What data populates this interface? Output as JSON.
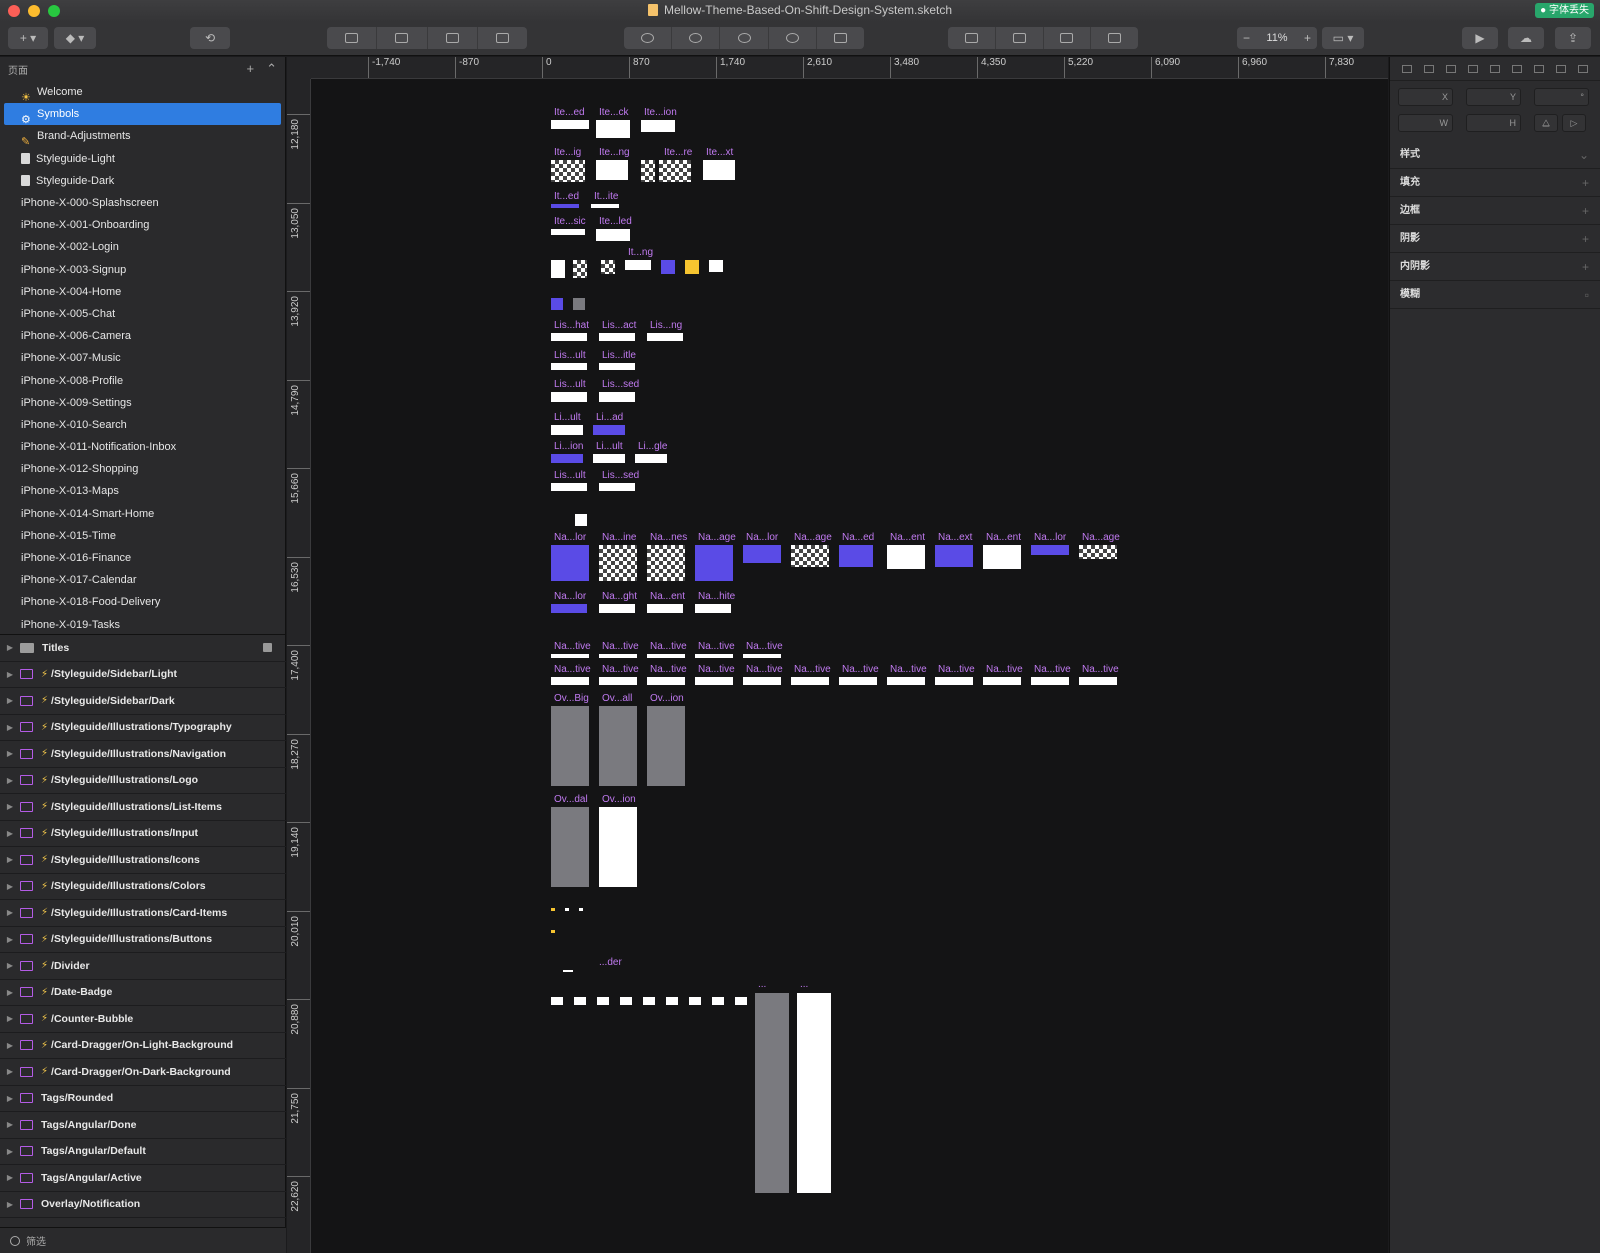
{
  "window": {
    "title": "Mellow-Theme-Based-On-Shift-Design-System.sketch",
    "badge": "● 字体丢失"
  },
  "toolbar": {
    "zoom": "11%"
  },
  "pages_header": "页面",
  "pages": [
    {
      "label": "Welcome",
      "icon": "sun-icon"
    },
    {
      "label": "Symbols",
      "icon": "gear-icon",
      "selected": true
    },
    {
      "label": "Brand-Adjustments",
      "icon": "pencil-icon"
    },
    {
      "label": "Styleguide-Light",
      "icon": "document-icon"
    },
    {
      "label": "Styleguide-Dark",
      "icon": "document-icon"
    },
    {
      "label": "iPhone-X-000-Splashscreen"
    },
    {
      "label": "iPhone-X-001-Onboarding"
    },
    {
      "label": "iPhone-X-002-Login"
    },
    {
      "label": "iPhone-X-003-Signup"
    },
    {
      "label": "iPhone-X-004-Home"
    },
    {
      "label": "iPhone-X-005-Chat"
    },
    {
      "label": "iPhone-X-006-Camera"
    },
    {
      "label": "iPhone-X-007-Music"
    },
    {
      "label": "iPhone-X-008-Profile"
    },
    {
      "label": "iPhone-X-009-Settings"
    },
    {
      "label": "iPhone-X-010-Search"
    },
    {
      "label": "iPhone-X-011-Notification-Inbox"
    },
    {
      "label": "iPhone-X-012-Shopping"
    },
    {
      "label": "iPhone-X-013-Maps"
    },
    {
      "label": "iPhone-X-014-Smart-Home"
    },
    {
      "label": "iPhone-X-015-Time"
    },
    {
      "label": "iPhone-X-016-Finance"
    },
    {
      "label": "iPhone-X-017-Calendar"
    },
    {
      "label": "iPhone-X-018-Food-Delivery"
    },
    {
      "label": "iPhone-X-019-Tasks"
    }
  ],
  "layers": [
    {
      "label": "Titles",
      "type": "folder",
      "locked": true
    },
    {
      "label": "/Styleguide/Sidebar/Light",
      "type": "symbol"
    },
    {
      "label": "/Styleguide/Sidebar/Dark",
      "type": "symbol"
    },
    {
      "label": "/Styleguide/Illustrations/Typography",
      "type": "symbol"
    },
    {
      "label": "/Styleguide/Illustrations/Navigation",
      "type": "symbol"
    },
    {
      "label": "/Styleguide/Illustrations/Logo",
      "type": "symbol"
    },
    {
      "label": "/Styleguide/Illustrations/List-Items",
      "type": "symbol"
    },
    {
      "label": "/Styleguide/Illustrations/Input",
      "type": "symbol"
    },
    {
      "label": "/Styleguide/Illustrations/Icons",
      "type": "symbol"
    },
    {
      "label": "/Styleguide/Illustrations/Colors",
      "type": "symbol"
    },
    {
      "label": "/Styleguide/Illustrations/Card-Items",
      "type": "symbol"
    },
    {
      "label": "/Styleguide/Illustrations/Buttons",
      "type": "symbol"
    },
    {
      "label": "/Divider",
      "type": "symbol"
    },
    {
      "label": "/Date-Badge",
      "type": "symbol"
    },
    {
      "label": "/Counter-Bubble",
      "type": "symbol"
    },
    {
      "label": "/Card-Dragger/On-Light-Background",
      "type": "symbol"
    },
    {
      "label": "/Card-Dragger/On-Dark-Background",
      "type": "symbol"
    },
    {
      "label": "Tags/Rounded",
      "type": "plain"
    },
    {
      "label": "Tags/Angular/Done",
      "type": "plain"
    },
    {
      "label": "Tags/Angular/Default",
      "type": "plain"
    },
    {
      "label": "Tags/Angular/Active",
      "type": "plain"
    },
    {
      "label": "Overlay/Notification",
      "type": "plain"
    }
  ],
  "filter": "筛选",
  "rulers": {
    "h": [
      "-1,740",
      "-870",
      "0",
      "870",
      "1,740",
      "2,610",
      "3,480",
      "4,350",
      "5,220",
      "6,090",
      "6,960",
      "7,830"
    ],
    "v": [
      "12,180",
      "13,050",
      "13,920",
      "14,790",
      "15,660",
      "16,530",
      "17,400",
      "18,270",
      "19,140",
      "20,010",
      "20,880",
      "21,750",
      "22,620"
    ]
  },
  "inspector": {
    "fields": {
      "x": "X",
      "y": "Y",
      "w": "W",
      "h": "H",
      "deg": "°"
    },
    "sections": [
      "样式",
      "填充",
      "边框",
      "阴影",
      "内阴影",
      "模糊"
    ]
  },
  "artboard_labels": {
    "r1": [
      "Ite...ed",
      "Ite...ck",
      "Ite...ion"
    ],
    "r2": [
      "Ite...ig",
      "Ite...ng",
      "Ite...re",
      "Ite...xt"
    ],
    "r3": [
      "It...ed",
      "It...ite"
    ],
    "r4": [
      "Ite...sic",
      "Ite...led"
    ],
    "r5": [
      "It...ng"
    ],
    "r6": [
      "Lis...hat",
      "Lis...act",
      "Lis...ng"
    ],
    "r7": [
      "Lis...ult",
      "Lis...itle"
    ],
    "r8": [
      "Lis...ult",
      "Lis...sed"
    ],
    "r9": [
      "Li...ult",
      "Li...ad"
    ],
    "r10": [
      "Li...ion",
      "Li...ult",
      "Li...gle"
    ],
    "r11": [
      "Lis...ult",
      "Lis...sed"
    ],
    "r12": [
      "Na...lor",
      "Na...ine",
      "Na...nes",
      "Na...age",
      "Na...lor",
      "Na...age",
      "Na...ed",
      "Na...ent",
      "Na...ext",
      "Na...ent",
      "Na...lor",
      "Na...age"
    ],
    "r13": [
      "Na...lor",
      "Na...ght",
      "Na...ent",
      "Na...hite"
    ],
    "r14": [
      "Na...tive",
      "Na...tive",
      "Na...tive",
      "Na...tive",
      "Na...tive"
    ],
    "r15": [
      "Na...tive",
      "Na...tive",
      "Na...tive",
      "Na...tive",
      "Na...tive",
      "Na...tive",
      "Na...tive",
      "Na...tive",
      "Na...tive",
      "Na...tive",
      "Na...tive",
      "Na...tive"
    ],
    "r16": [
      "Ov...Big",
      "Ov...all",
      "Ov...ion"
    ],
    "r17": [
      "Ov...dal",
      "Ov...ion"
    ],
    "r18": [
      "...der"
    ],
    "r19": [
      "...",
      "..."
    ]
  },
  "colors": {
    "accent": "#2f7de1",
    "symbol_label": "#c07af0",
    "brand_blue": "#5a4be6",
    "brand_yellow": "#f6c430"
  }
}
